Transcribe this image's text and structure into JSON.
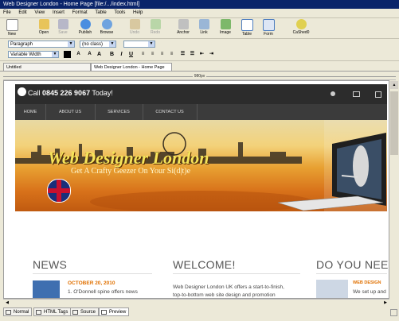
{
  "window": {
    "title": "Web Designer London - Home Page [file:/.../index.html]"
  },
  "menu": [
    "File",
    "Edit",
    "View",
    "Insert",
    "Format",
    "Table",
    "Tools",
    "Help"
  ],
  "toolbar": {
    "new": "New",
    "open": "Open",
    "save": "Save",
    "publish": "Publish",
    "browse": "Browse",
    "undo": "Undo",
    "redo": "Redo",
    "anchor": "Anchor",
    "link": "Link",
    "image": "Image",
    "table": "Table",
    "form": "Form",
    "cashed": "CaShed0"
  },
  "format": {
    "paragraph": "Paragraph",
    "font": "(no class)",
    "width": "Variable Width",
    "bold": "B",
    "italic": "I",
    "underline": "U"
  },
  "tabs": {
    "untitled": "Untitled",
    "home": "Web Designer London - Home Page"
  },
  "ruler": {
    "label": "980px"
  },
  "site": {
    "phone_prefix": "Call ",
    "phone_number": "0845 226 9067",
    "phone_suffix": " Today!",
    "nav": [
      "HOME",
      "ABOUT US",
      "SERVICES",
      "CONTACT US"
    ],
    "logo": "Web Designer London",
    "tagline": "Get A Crafty Geezer On Your Si(d|t)e",
    "news_title": "NEWS",
    "news_date": "OCTOBER 20, 2010",
    "news_text": "1. O'Donnell spine offers news",
    "welcome_title": "WELCOME!",
    "welcome_text_1": "Web Designer London UK offers a start-to-finish,",
    "welcome_text_2": "top-to-bottom web site design and promotion",
    "need_title": "DO YOU NEED A",
    "need_sub": "WEB DESIGN",
    "need_text": "We set up and"
  },
  "view_tabs": {
    "normal": "Normal",
    "html_tags": "HTML Tags",
    "source": "Source",
    "preview": "Preview"
  },
  "colors": {
    "titlebar": "#0a246a",
    "site_dark": "#2c2c2c",
    "orange": "#e8a132",
    "accent_date": "#e07000"
  }
}
